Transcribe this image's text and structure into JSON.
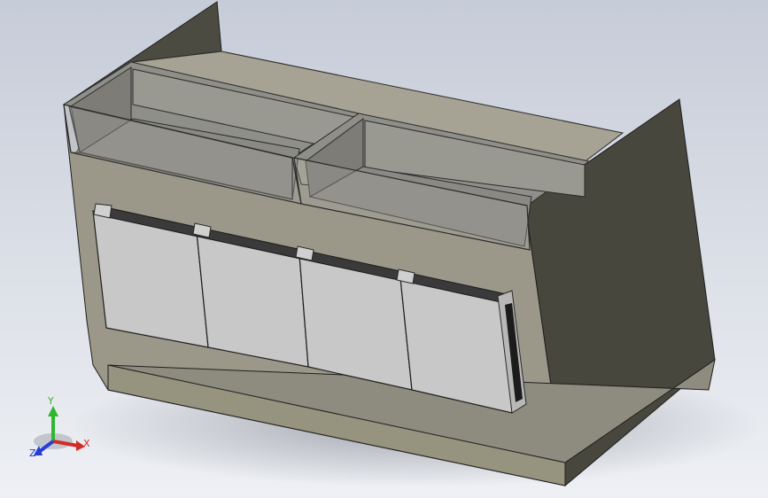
{
  "viewport": {
    "background_top": "#c6ccd8",
    "background_bottom": "#eef0f4"
  },
  "model": {
    "name": "",
    "colors": {
      "body": "#9a978a",
      "body_dark": "#47473d",
      "panel": "#c8c8c8",
      "glass": "#8f8f89",
      "rail": "#3a3a3a"
    }
  },
  "triad": {
    "x_label": "X",
    "y_label": "Y",
    "z_label": "Z",
    "x_color": "#d42a2a",
    "y_color": "#2fb82f",
    "z_color": "#2a3bd4"
  }
}
